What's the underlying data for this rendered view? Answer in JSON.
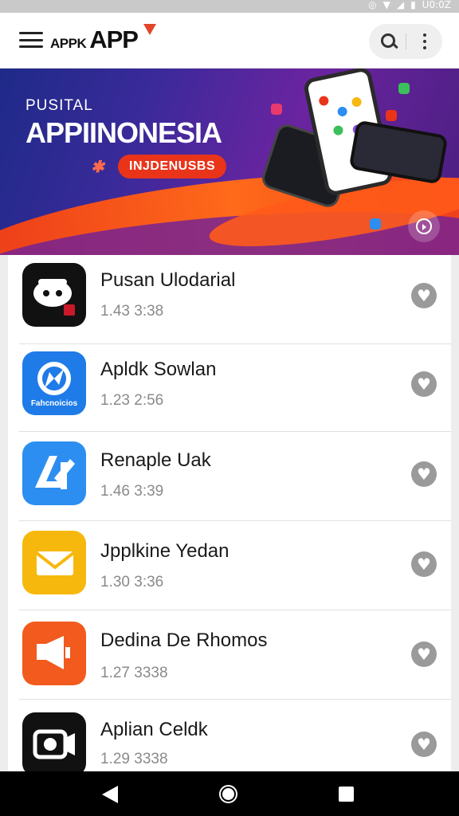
{
  "status_bar": {
    "time": "U0:0Z",
    "icons": [
      "location-icon",
      "wifi-icon",
      "signal-icon",
      "battery-icon"
    ]
  },
  "app_bar": {
    "logo_small": "APPK",
    "logo_big": "APP",
    "icons": [
      "menu-icon",
      "search-icon",
      "more-vert-icon"
    ]
  },
  "banner": {
    "subtitle": "PUSITAL",
    "title": "APPIINONESIA",
    "mark": "✱",
    "pill": "INJDENUSBS",
    "next_icon": "play-circle-icon"
  },
  "apps": [
    {
      "name": "Pusan Ulodarial",
      "meta": "1.43 3:38",
      "icon": "robot-icon",
      "color": "#111111"
    },
    {
      "name": "Apldk Sowlan",
      "meta": "1.23 2:56",
      "icon": "compass-icon",
      "color": "#1e7be8",
      "icon_label": "Fahcnoicios"
    },
    {
      "name": "Renaple Uak",
      "meta": "1.46 3:39",
      "icon": "a-letter-icon",
      "color": "#2c8ef0"
    },
    {
      "name": "Jpplkine Yedan",
      "meta": "1.30 3:36",
      "icon": "mail-icon",
      "color": "#f7b80e"
    },
    {
      "name": "Dedina De Rhomos",
      "meta": "1.27 3338",
      "icon": "megaphone-icon",
      "color": "#f25a1e"
    },
    {
      "name": "Aplian Celdk",
      "meta": "1.29 3338",
      "icon": "camera-icon",
      "color": "#111111"
    }
  ],
  "nav": {
    "icons": [
      "back-icon",
      "home-icon",
      "recent-apps-icon"
    ]
  },
  "colors": {
    "accent": "#e9341a",
    "banner_dark": "#2a2a90",
    "heart": "#9a9a9a"
  }
}
